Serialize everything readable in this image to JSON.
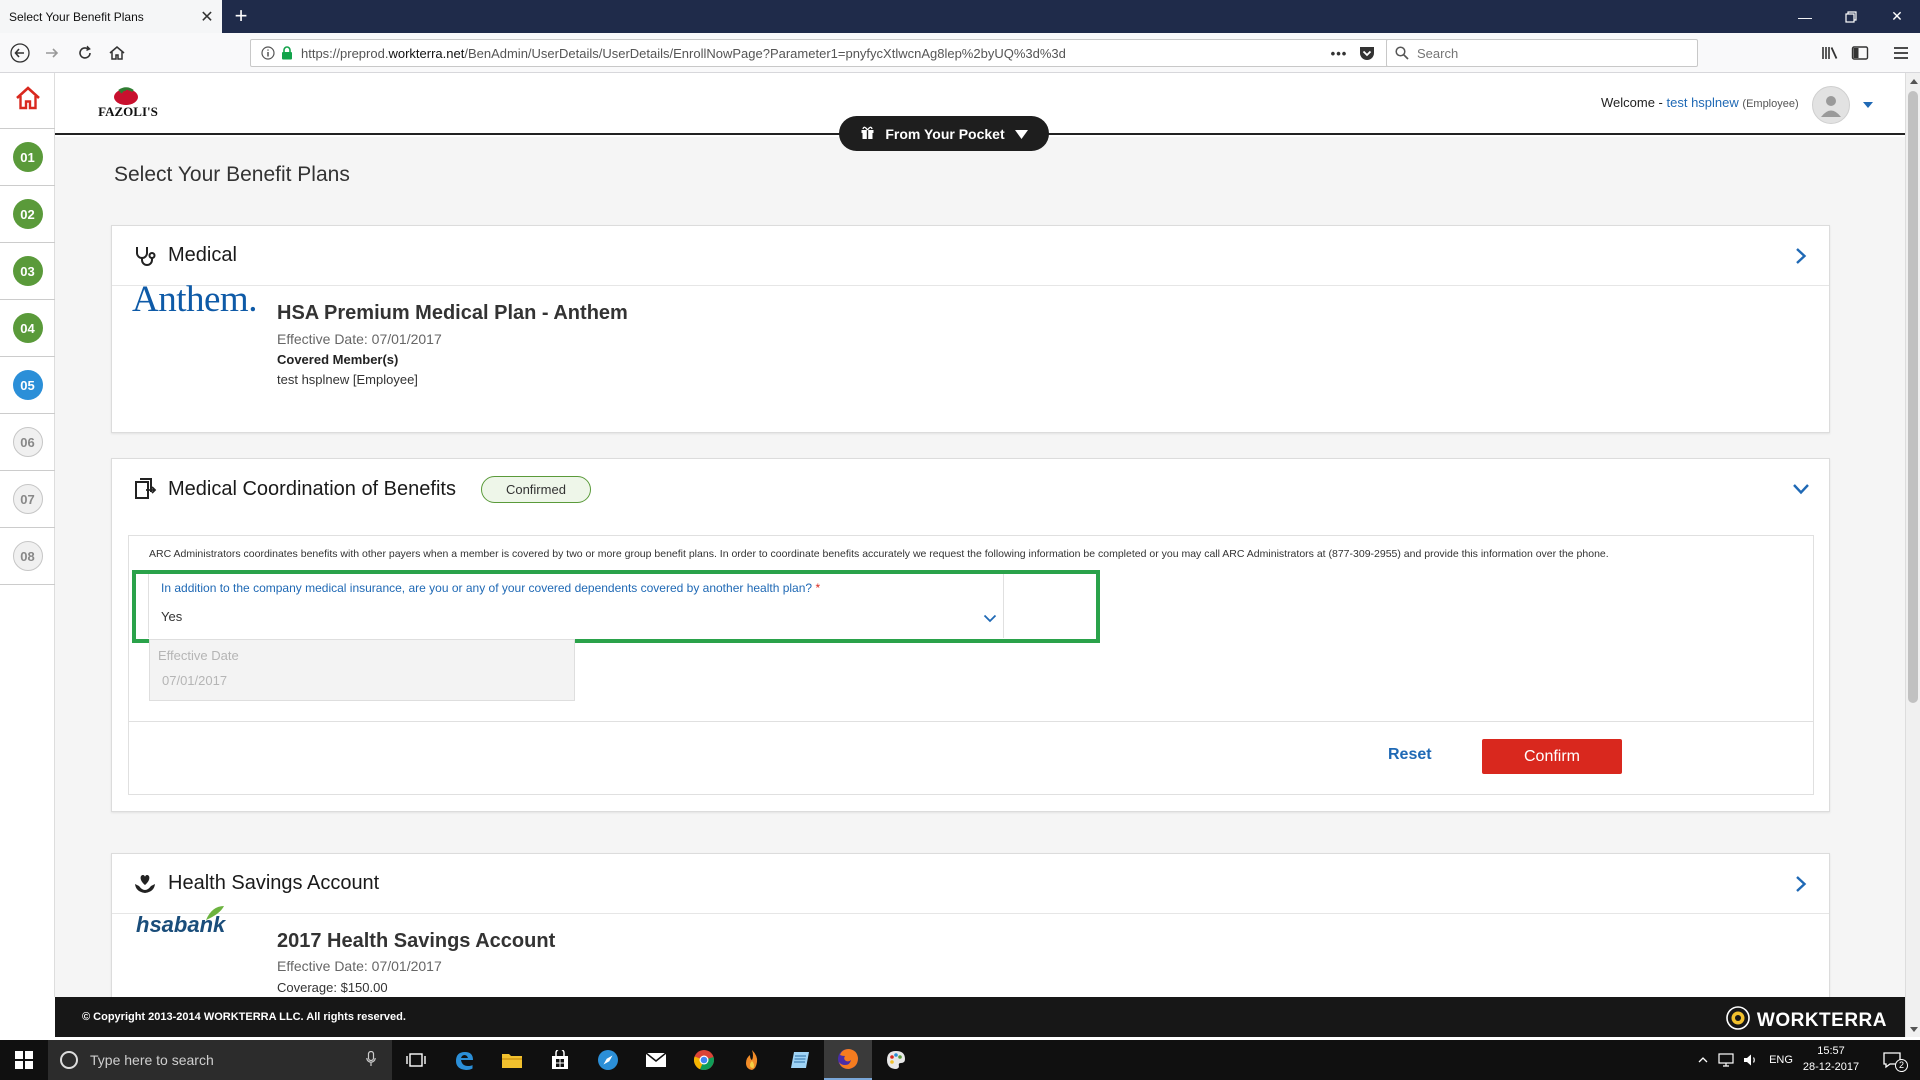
{
  "browser": {
    "tab_title": "Select Your Benefit Plans",
    "url_prefix": "https://preprod.",
    "url_domain": "workterra.net",
    "url_path": "/BenAdmin/UserDetails/UserDetails/EnrollNowPage?Parameter1=pnyfycXtlwcnAg8lep%2byUQ%3d%3d",
    "search_placeholder": "Search"
  },
  "sidebar": {
    "steps": [
      {
        "label": "01",
        "state": "done"
      },
      {
        "label": "02",
        "state": "done"
      },
      {
        "label": "03",
        "state": "done"
      },
      {
        "label": "04",
        "state": "done"
      },
      {
        "label": "05",
        "state": "active"
      },
      {
        "label": "06",
        "state": "pending"
      },
      {
        "label": "07",
        "state": "pending"
      },
      {
        "label": "08",
        "state": "pending"
      }
    ]
  },
  "header": {
    "logo_text": "FAZOLI'S",
    "welcome_prefix": "Welcome -",
    "user_name": "test hsplnew",
    "user_role": "(Employee)",
    "pocket_label": "From Your Pocket"
  },
  "page": {
    "title": "Select Your Benefit Plans"
  },
  "medical": {
    "title": "Medical",
    "carrier_logo": "Anthem.",
    "plan_name": "HSA Premium Medical Plan - Anthem",
    "effective": "Effective Date: 07/01/2017",
    "covered_label": "Covered Member(s)",
    "covered_value": "test hsplnew [Employee]"
  },
  "cob": {
    "title": "Medical Coordination of Benefits",
    "badge": "Confirmed",
    "description": "ARC Administrators coordinates benefits with other payers when a member is covered by two or more group benefit plans. In order to coordinate benefits accurately we request the following information be completed or you may call ARC Administrators at (877-309-2955) and provide this information over the phone.",
    "question": "In addition to the company medical insurance, are you or any of your covered dependents covered by another health plan?",
    "required_mark": "*",
    "answer": "Yes",
    "effective_label": "Effective Date",
    "effective_value": "07/01/2017",
    "reset_label": "Reset",
    "confirm_label": "Confirm"
  },
  "hsa": {
    "title": "Health Savings Account",
    "carrier_logo": "hsabank",
    "plan_name": "2017 Health Savings Account",
    "effective": "Effective Date: 07/01/2017",
    "coverage": "Coverage: $150.00"
  },
  "footer": {
    "copyright": "© Copyright 2013-2014 WORKTERRA LLC. All rights reserved.",
    "brand": "WORKTERRA"
  },
  "taskbar": {
    "search_placeholder": "Type here to search",
    "language": "ENG",
    "time": "15:57",
    "date": "28-12-2017",
    "notification_count": "2"
  },
  "colors": {
    "accent_blue": "#1f69b5",
    "confirm_red": "#d9281e",
    "step_done_green": "#5a9a3a",
    "step_active_blue": "#2b8fd8",
    "highlight_green": "#2aa24a"
  }
}
